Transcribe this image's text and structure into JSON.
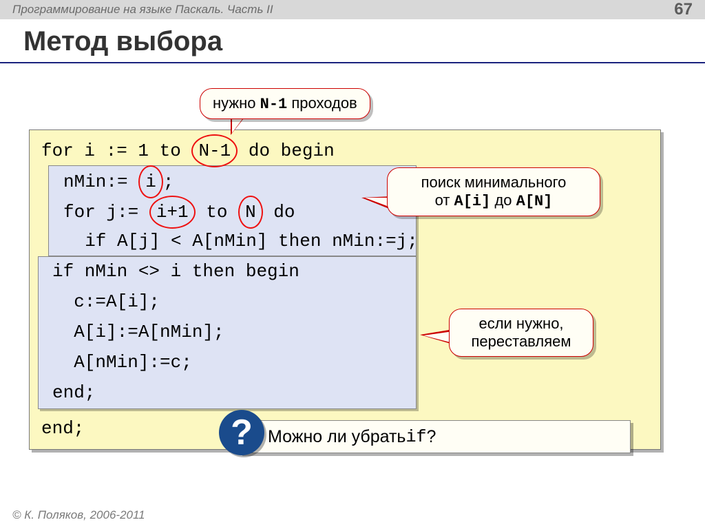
{
  "header": {
    "course": "Программирование на языке Паскаль. Часть II",
    "page": "67"
  },
  "title": "Метод выбора",
  "callouts": {
    "passes_pre": "нужно ",
    "passes_code": "N-1",
    "passes_post": " проходов",
    "search_line1": "поиск минимального",
    "search_line2_pre": "от ",
    "search_line2_code1": "A[i]",
    "search_line2_mid": " до ",
    "search_line2_code2": "A[N]",
    "swap_line1": "если нужно,",
    "swap_line2": "переставляем"
  },
  "code": {
    "l1a": "for i := 1 to ",
    "l1_circ": "N-1",
    "l1b": " do begin",
    "l2a": "nMin:= ",
    "l2_circ": "i",
    "l2b": ";",
    "l3a": "for j:= ",
    "l3_circ1": "i+1",
    "l3_mid": " to ",
    "l3_circ2": "N",
    "l3b": " do",
    "l4": "  if A[j] < A[nMin] then nMin:=j;",
    "l5": "if nMin <> i then begin",
    "l6": "  c:=A[i];",
    "l7": "  A[i]:=A[nMin];",
    "l8": "  A[nMin]:=c;",
    "l9": "end;",
    "l10": "end;"
  },
  "question": {
    "mark": "?",
    "text_pre": "Можно ли убрать ",
    "text_code": "if",
    "text_post": "?"
  },
  "footer": "© К. Поляков, 2006-2011"
}
